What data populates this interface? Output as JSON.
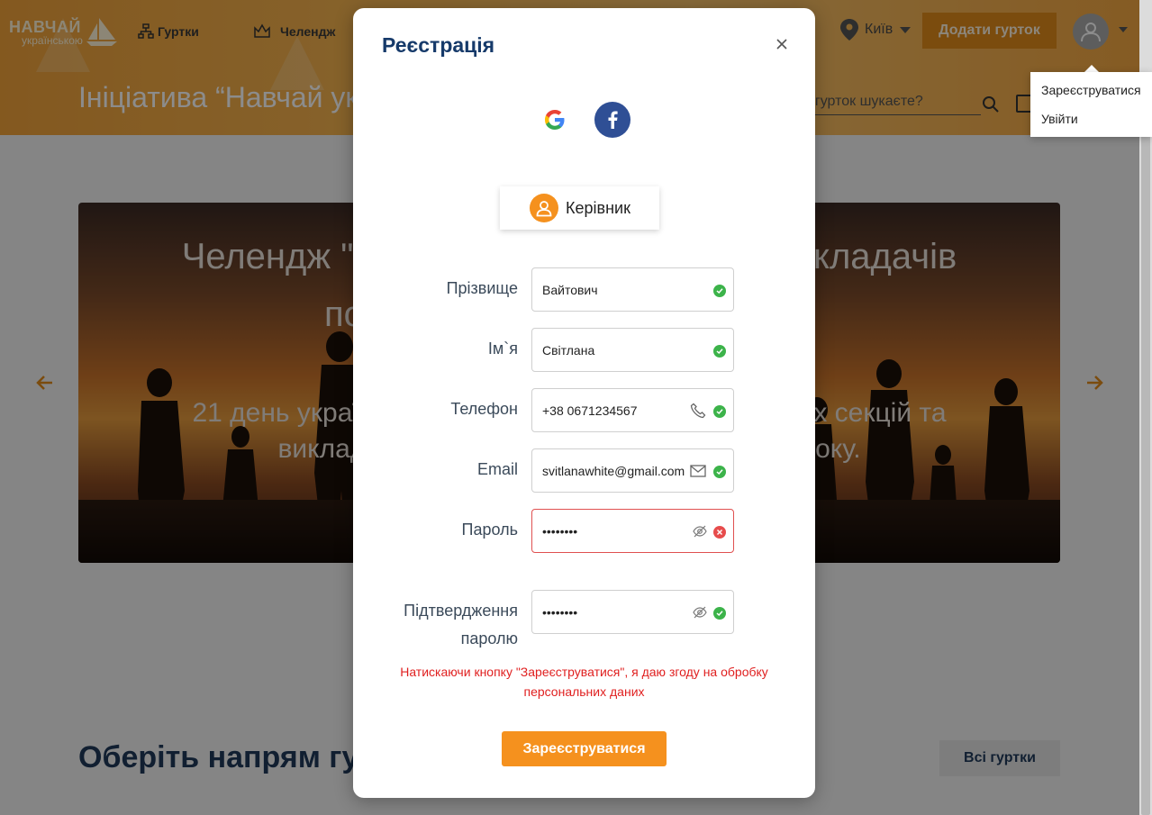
{
  "header": {
    "logo_line1": "НАВЧАЙ",
    "logo_line2": "українською",
    "nav": [
      {
        "label": "Гуртки"
      },
      {
        "label": "Челендж"
      }
    ],
    "city": "Київ",
    "add_club_label": "Додати гурток",
    "search_placeholder": "Який гурток шукаєте?"
  },
  "hero": {
    "initiative_title": "Ініціатива “Навчай українською”"
  },
  "banner": {
    "title": "Челендж \"Навчай українською\"для викладачів позашкільних закладів освіти",
    "subtitle": "21 день української мови для тренерів спортивних секцій та викладачів гуртків. Старт 1 вересня 2021 року."
  },
  "section": {
    "title": "Оберіть напрям гуртків",
    "all_label": "Всі гуртки"
  },
  "user_menu": {
    "items": [
      {
        "label": "Зареєструватися"
      },
      {
        "label": "Увійти"
      }
    ]
  },
  "modal": {
    "title": "Реєстрація",
    "role_label": "Керівник",
    "fields": {
      "last_name": {
        "label": "Прізвище",
        "value": "Вайтович",
        "status": "valid"
      },
      "first_name": {
        "label": "Ім`я",
        "value": "Світлана",
        "status": "valid"
      },
      "phone": {
        "label": "Телефон",
        "value": "+38 0671234567",
        "status": "valid"
      },
      "email": {
        "label": "Email",
        "value": "svitlanawhite@gmail.com",
        "status": "valid"
      },
      "password": {
        "label": "Пароль",
        "value": "••••••••",
        "status": "invalid"
      },
      "confirm": {
        "label_line1": "Підтвердження",
        "label_line2": "паролю",
        "value": "••••••••",
        "status": "valid"
      }
    },
    "consent": "Натискаючи кнопку \"Зареєструватися\", я даю згоду на обробку персональних даних",
    "submit_label": "Зареєструватися"
  },
  "colors": {
    "accent": "#f5911e",
    "title": "#163a6a",
    "valid": "#3cb34a",
    "invalid": "#e74c4c",
    "consent": "#e02020"
  }
}
